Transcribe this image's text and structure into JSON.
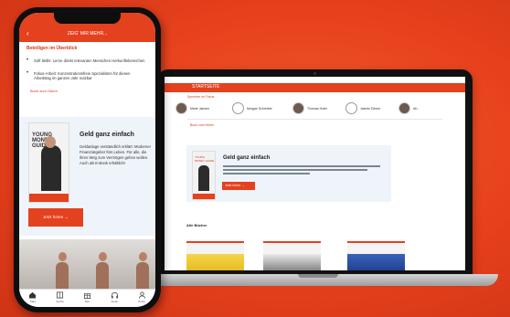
{
  "colors": {
    "accent": "#e4411e",
    "background": "#e9421f",
    "promo_bg": "#eef4f9"
  },
  "phone": {
    "header_title": "ZEIG' MIR MEHR...",
    "back_icon": "arrow-left-icon",
    "section_title": "Beteiligen im Überblick",
    "bullets": [
      "Soft Skills: Lerne direkt relevanten Menschen  Herkunftsbereichen",
      "Fokus-Arbeit: Konzentrationsfreie Spezialisten für diesen Arbeitstag im ganzen Jahr nutzbar"
    ],
    "book_label": "Buch zum Hören",
    "book_cover_title": "YOUNG MONEY GUIDE",
    "promo_title": "Geld ganz einfach",
    "promo_text": "Geldanlage  verständlich erklärt: Moderner Finanzratgeber fürs Leben. Für alle, die ihren Weg zum Vermögen gehen wollen. Auch als E-Book erhältlich!",
    "promo_button": "Jetzt hören →",
    "tabs": [
      {
        "label": "Start",
        "icon": "home-icon"
      },
      {
        "label": "Suche",
        "icon": "book-icon"
      },
      {
        "label": "Neu",
        "icon": "gift-icon"
      },
      {
        "label": "Audio",
        "icon": "headphones-icon"
      },
      {
        "label": "Konto",
        "icon": "user-icon"
      }
    ]
  },
  "laptop": {
    "header_title": "STARTSEITE",
    "speakers_label": "Sprecher im Fokus",
    "speakers": [
      {
        "name": "Marie Jansen",
        "icon": "avatar"
      },
      {
        "name": "Morgan Schreiber",
        "icon": "headphones-icon"
      },
      {
        "name": "Thomas Hofer",
        "icon": "avatar"
      },
      {
        "name": "Jasmin Dinner",
        "icon": "headphones-icon"
      },
      {
        "name": "Ab...",
        "icon": "avatar"
      }
    ],
    "more_icon": "chevron-right-icon",
    "book_label": "Buch zum Hören",
    "promo_title": "Geld ganz einfach",
    "promo_button": "Jetzt hören →",
    "bestsellers_title": "Alle Bücher"
  }
}
